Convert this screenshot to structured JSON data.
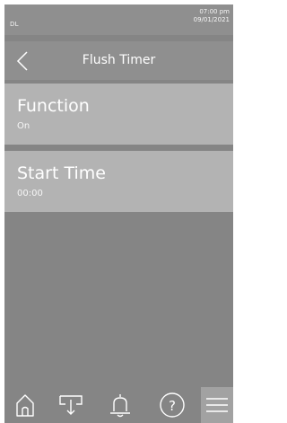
{
  "status": {
    "left": "DL",
    "time": "07:00 pm",
    "date": "09/01/2021"
  },
  "header": {
    "title": "Flush Timer",
    "back_icon": "chevron-left-icon"
  },
  "settings": [
    {
      "label": "Function",
      "value": "On"
    },
    {
      "label": "Start Time",
      "value": "00:00"
    }
  ],
  "nav": {
    "items": [
      "home-icon",
      "dispense-icon",
      "bell-icon",
      "help-icon",
      "menu-icon"
    ],
    "active": "menu-icon"
  },
  "colors": {
    "background": "#858585",
    "card": "#b3b3b3",
    "header": "#8f8f8f",
    "active_nav": "#a2a2a2",
    "text": "#ffffff"
  }
}
